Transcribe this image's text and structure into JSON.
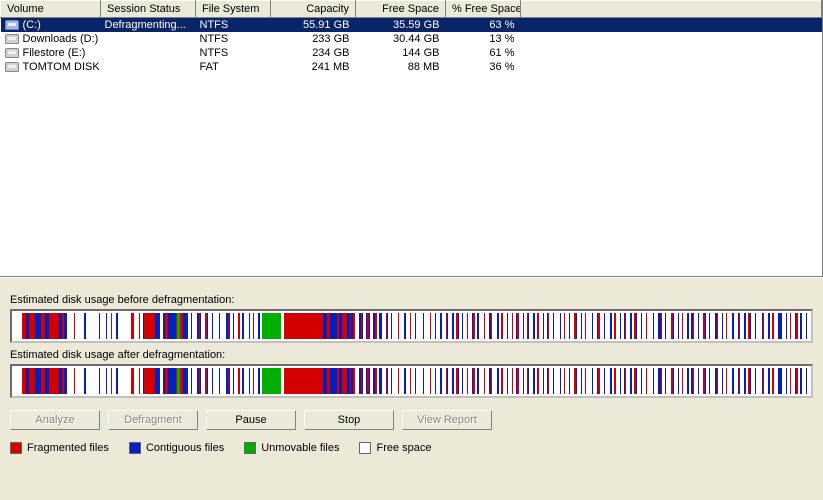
{
  "columns": {
    "volume": "Volume",
    "session_status": "Session Status",
    "file_system": "File System",
    "capacity": "Capacity",
    "free_space": "Free Space",
    "pct_free": "% Free Space"
  },
  "col_widths": {
    "volume": 100,
    "session_status": 95,
    "file_system": 75,
    "capacity": 85,
    "free_space": 90,
    "pct_free": 75
  },
  "volumes": [
    {
      "name": "(C:)",
      "status": "Defragmenting...",
      "fs": "NTFS",
      "capacity": "55.91 GB",
      "free": "35.59 GB",
      "pct": "63 %",
      "selected": true
    },
    {
      "name": "Downloads (D:)",
      "status": "",
      "fs": "NTFS",
      "capacity": "233 GB",
      "free": "30.44 GB",
      "pct": "13 %",
      "selected": false
    },
    {
      "name": "Filestore (E:)",
      "status": "",
      "fs": "NTFS",
      "capacity": "234 GB",
      "free": "144 GB",
      "pct": "61 %",
      "selected": false
    },
    {
      "name": "TOMTOM DISK (G:)",
      "status": "",
      "fs": "FAT",
      "capacity": "241 MB",
      "free": "88 MB",
      "pct": "36 %",
      "selected": false
    }
  ],
  "labels": {
    "before": "Estimated disk usage before defragmentation:",
    "after": "Estimated disk usage after defragmentation:"
  },
  "buttons": {
    "analyze": "Analyze",
    "defragment": "Defragment",
    "pause": "Pause",
    "stop": "Stop",
    "view_report": "View Report"
  },
  "button_state": {
    "analyze": "disabled",
    "defragment": "disabled",
    "pause": "enabled",
    "stop": "enabled",
    "view_report": "disabled"
  },
  "legend": {
    "fragmented": "Fragmented files",
    "contiguous": "Contiguous files",
    "unmovable": "Unmovable files",
    "free": "Free space"
  },
  "stripes_before": [
    [
      "w",
      6
    ],
    [
      "r",
      3
    ],
    [
      "b",
      2
    ],
    [
      "r",
      5
    ],
    [
      "b",
      4
    ],
    [
      "r",
      3
    ],
    [
      "b",
      3
    ],
    [
      "r",
      8
    ],
    [
      "b",
      2
    ],
    [
      "r",
      2
    ],
    [
      "b",
      2
    ],
    [
      "w",
      5
    ],
    [
      "r",
      1
    ],
    [
      "w",
      7
    ],
    [
      "b",
      1
    ],
    [
      "w",
      10
    ],
    [
      "b",
      1
    ],
    [
      "w",
      4
    ],
    [
      "b",
      1
    ],
    [
      "w",
      3
    ],
    [
      "r",
      1
    ],
    [
      "w",
      3
    ],
    [
      "b",
      1
    ],
    [
      "w",
      10
    ],
    [
      "r",
      2
    ],
    [
      "w",
      4
    ],
    [
      "r",
      1
    ],
    [
      "w",
      2
    ],
    [
      "b",
      1
    ],
    [
      "r",
      8
    ],
    [
      "b",
      4
    ],
    [
      "w",
      2
    ],
    [
      "b",
      2
    ],
    [
      "r",
      2
    ],
    [
      "b",
      6
    ],
    [
      "r",
      1
    ],
    [
      "g",
      2
    ],
    [
      "r",
      2
    ],
    [
      "b",
      4
    ],
    [
      "w",
      2
    ],
    [
      "b",
      1
    ],
    [
      "w",
      4
    ],
    [
      "b",
      1
    ],
    [
      "r",
      1
    ],
    [
      "b",
      1
    ],
    [
      "w",
      3
    ],
    [
      "r",
      1
    ],
    [
      "b",
      1
    ],
    [
      "w",
      3
    ],
    [
      "b",
      1
    ],
    [
      "w",
      4
    ],
    [
      "b",
      1
    ],
    [
      "w",
      5
    ],
    [
      "b",
      1
    ],
    [
      "r",
      1
    ],
    [
      "b",
      1
    ],
    [
      "w",
      2
    ],
    [
      "b",
      1
    ],
    [
      "w",
      3
    ],
    [
      "r",
      1
    ],
    [
      "w",
      2
    ],
    [
      "b",
      1
    ],
    [
      "w",
      4
    ],
    [
      "b",
      1
    ],
    [
      "w",
      2
    ],
    [
      "r",
      1
    ],
    [
      "w",
      3
    ],
    [
      "b",
      1
    ],
    [
      "w",
      2
    ],
    [
      "g",
      14
    ],
    [
      "w",
      2
    ],
    [
      "r",
      30
    ],
    [
      "b",
      3
    ],
    [
      "r",
      2
    ],
    [
      "b",
      5
    ],
    [
      "r",
      2
    ],
    [
      "b",
      2
    ],
    [
      "r",
      4
    ],
    [
      "b",
      2
    ],
    [
      "r",
      1
    ],
    [
      "b",
      1
    ],
    [
      "r",
      2
    ],
    [
      "w",
      3
    ],
    [
      "b",
      1
    ],
    [
      "r",
      1
    ],
    [
      "b",
      1
    ],
    [
      "w",
      2
    ],
    [
      "b",
      1
    ],
    [
      "r",
      1
    ],
    [
      "b",
      1
    ],
    [
      "w",
      2
    ],
    [
      "b",
      2
    ],
    [
      "r",
      1
    ],
    [
      "w",
      2
    ],
    [
      "b",
      2
    ],
    [
      "w",
      3
    ],
    [
      "r",
      1
    ],
    [
      "b",
      1
    ],
    [
      "w",
      2
    ],
    [
      "b",
      1
    ],
    [
      "w",
      4
    ],
    [
      "r",
      1
    ],
    [
      "w",
      4
    ],
    [
      "b",
      1
    ],
    [
      "w",
      3
    ],
    [
      "r",
      1
    ],
    [
      "w",
      3
    ],
    [
      "b",
      1
    ],
    [
      "w",
      5
    ],
    [
      "b",
      1
    ],
    [
      "w",
      4
    ],
    [
      "r",
      1
    ],
    [
      "w",
      3
    ],
    [
      "b",
      1
    ],
    [
      "w",
      3
    ],
    [
      "b",
      1
    ],
    [
      "w",
      3
    ],
    [
      "r",
      1
    ],
    [
      "b",
      1
    ],
    [
      "w",
      3
    ],
    [
      "b",
      1
    ],
    [
      "w",
      2
    ],
    [
      "r",
      1
    ],
    [
      "b",
      1
    ],
    [
      "w",
      2
    ],
    [
      "b",
      1
    ],
    [
      "w",
      3
    ],
    [
      "r",
      1
    ],
    [
      "w",
      3
    ],
    [
      "b",
      1
    ],
    [
      "r",
      1
    ],
    [
      "w",
      2
    ],
    [
      "b",
      1
    ],
    [
      "w",
      4
    ],
    [
      "r",
      1
    ],
    [
      "w",
      3
    ],
    [
      "b",
      1
    ],
    [
      "r",
      1
    ],
    [
      "w",
      4
    ],
    [
      "b",
      1
    ],
    [
      "w",
      2
    ],
    [
      "r",
      1
    ],
    [
      "w",
      3
    ],
    [
      "b",
      1
    ],
    [
      "w",
      3
    ],
    [
      "r",
      1
    ],
    [
      "w",
      2
    ],
    [
      "b",
      1
    ],
    [
      "r",
      1
    ],
    [
      "w",
      3
    ],
    [
      "b",
      1
    ],
    [
      "w",
      2
    ],
    [
      "r",
      1
    ],
    [
      "b",
      1
    ],
    [
      "w",
      3
    ],
    [
      "b",
      1
    ],
    [
      "w",
      2
    ],
    [
      "r",
      1
    ],
    [
      "w",
      3
    ],
    [
      "b",
      1
    ],
    [
      "w",
      2
    ],
    [
      "b",
      1
    ],
    [
      "r",
      1
    ],
    [
      "w",
      3
    ],
    [
      "b",
      1
    ],
    [
      "w",
      4
    ],
    [
      "b",
      1
    ],
    [
      "w",
      2
    ],
    [
      "r",
      1
    ],
    [
      "w",
      3
    ],
    [
      "b",
      1
    ],
    [
      "w",
      3
    ],
    [
      "r",
      1
    ],
    [
      "b",
      1
    ],
    [
      "w",
      3
    ],
    [
      "b",
      1
    ],
    [
      "w",
      2
    ],
    [
      "r",
      1
    ],
    [
      "w",
      4
    ],
    [
      "b",
      1
    ],
    [
      "w",
      3
    ],
    [
      "b",
      1
    ],
    [
      "r",
      1
    ],
    [
      "w",
      3
    ],
    [
      "b",
      1
    ],
    [
      "w",
      4
    ],
    [
      "b",
      1
    ],
    [
      "w",
      2
    ],
    [
      "r",
      1
    ],
    [
      "w",
      3
    ],
    [
      "b",
      1
    ],
    [
      "w",
      2
    ],
    [
      "b",
      1
    ],
    [
      "r",
      1
    ],
    [
      "w",
      3
    ],
    [
      "b",
      1
    ],
    [
      "w",
      2
    ],
    [
      "r",
      1
    ],
    [
      "b",
      1
    ],
    [
      "w",
      3
    ],
    [
      "b",
      1
    ],
    [
      "w",
      3
    ],
    [
      "r",
      1
    ],
    [
      "w",
      4
    ],
    [
      "b",
      1
    ],
    [
      "w",
      3
    ],
    [
      "b",
      2
    ],
    [
      "r",
      1
    ],
    [
      "w",
      2
    ],
    [
      "b",
      1
    ],
    [
      "w",
      4
    ],
    [
      "r",
      1
    ],
    [
      "b",
      1
    ],
    [
      "w",
      3
    ],
    [
      "b",
      1
    ],
    [
      "w",
      2
    ],
    [
      "r",
      1
    ],
    [
      "w",
      3
    ],
    [
      "b",
      1
    ],
    [
      "w",
      2
    ],
    [
      "b",
      1
    ],
    [
      "r",
      1
    ],
    [
      "w",
      3
    ],
    [
      "b",
      1
    ],
    [
      "w",
      3
    ],
    [
      "r",
      1
    ],
    [
      "b",
      1
    ],
    [
      "w",
      2
    ],
    [
      "b",
      1
    ],
    [
      "w",
      4
    ],
    [
      "b",
      1
    ],
    [
      "r",
      1
    ],
    [
      "w",
      3
    ],
    [
      "b",
      1
    ],
    [
      "w",
      2
    ],
    [
      "r",
      1
    ],
    [
      "w",
      4
    ],
    [
      "b",
      1
    ],
    [
      "w",
      3
    ],
    [
      "b",
      1
    ],
    [
      "r",
      1
    ],
    [
      "w",
      3
    ],
    [
      "b",
      1
    ],
    [
      "w",
      2
    ],
    [
      "r",
      1
    ],
    [
      "b",
      1
    ],
    [
      "w",
      3
    ],
    [
      "b",
      1
    ],
    [
      "w",
      4
    ],
    [
      "b",
      1
    ],
    [
      "r",
      1
    ],
    [
      "w",
      3
    ],
    [
      "b",
      1
    ],
    [
      "w",
      2
    ],
    [
      "r",
      1
    ],
    [
      "w",
      3
    ],
    [
      "b",
      3
    ],
    [
      "w",
      3
    ],
    [
      "b",
      1
    ],
    [
      "w",
      2
    ],
    [
      "r",
      1
    ],
    [
      "w",
      3
    ],
    [
      "b",
      1
    ],
    [
      "r",
      1
    ],
    [
      "w",
      2
    ],
    [
      "b",
      1
    ],
    [
      "w",
      3
    ],
    [
      "b",
      1
    ],
    [
      "w",
      5
    ]
  ],
  "stripes_after": [
    [
      "w",
      6
    ],
    [
      "r",
      3
    ],
    [
      "b",
      2
    ],
    [
      "r",
      5
    ],
    [
      "b",
      4
    ],
    [
      "r",
      3
    ],
    [
      "b",
      3
    ],
    [
      "r",
      8
    ],
    [
      "b",
      2
    ],
    [
      "r",
      2
    ],
    [
      "b",
      2
    ],
    [
      "w",
      5
    ],
    [
      "r",
      1
    ],
    [
      "w",
      7
    ],
    [
      "b",
      1
    ],
    [
      "w",
      10
    ],
    [
      "b",
      1
    ],
    [
      "w",
      4
    ],
    [
      "b",
      1
    ],
    [
      "w",
      3
    ],
    [
      "r",
      1
    ],
    [
      "w",
      3
    ],
    [
      "b",
      1
    ],
    [
      "w",
      10
    ],
    [
      "r",
      2
    ],
    [
      "w",
      4
    ],
    [
      "r",
      1
    ],
    [
      "w",
      2
    ],
    [
      "b",
      1
    ],
    [
      "r",
      8
    ],
    [
      "b",
      4
    ],
    [
      "w",
      2
    ],
    [
      "b",
      2
    ],
    [
      "r",
      2
    ],
    [
      "b",
      6
    ],
    [
      "r",
      1
    ],
    [
      "g",
      2
    ],
    [
      "r",
      2
    ],
    [
      "b",
      4
    ],
    [
      "w",
      2
    ],
    [
      "b",
      1
    ],
    [
      "w",
      4
    ],
    [
      "b",
      1
    ],
    [
      "r",
      1
    ],
    [
      "b",
      1
    ],
    [
      "w",
      3
    ],
    [
      "r",
      1
    ],
    [
      "b",
      1
    ],
    [
      "w",
      3
    ],
    [
      "b",
      1
    ],
    [
      "w",
      4
    ],
    [
      "b",
      1
    ],
    [
      "w",
      5
    ],
    [
      "b",
      1
    ],
    [
      "r",
      1
    ],
    [
      "b",
      1
    ],
    [
      "w",
      2
    ],
    [
      "b",
      1
    ],
    [
      "w",
      3
    ],
    [
      "r",
      1
    ],
    [
      "w",
      2
    ],
    [
      "b",
      1
    ],
    [
      "w",
      4
    ],
    [
      "b",
      1
    ],
    [
      "w",
      2
    ],
    [
      "r",
      1
    ],
    [
      "w",
      3
    ],
    [
      "b",
      1
    ],
    [
      "w",
      2
    ],
    [
      "g",
      14
    ],
    [
      "w",
      2
    ],
    [
      "r",
      30
    ],
    [
      "b",
      3
    ],
    [
      "r",
      2
    ],
    [
      "b",
      5
    ],
    [
      "r",
      2
    ],
    [
      "b",
      2
    ],
    [
      "r",
      4
    ],
    [
      "b",
      2
    ],
    [
      "r",
      1
    ],
    [
      "b",
      1
    ],
    [
      "r",
      2
    ],
    [
      "w",
      3
    ],
    [
      "b",
      1
    ],
    [
      "r",
      1
    ],
    [
      "b",
      1
    ],
    [
      "w",
      2
    ],
    [
      "b",
      1
    ],
    [
      "r",
      1
    ],
    [
      "b",
      1
    ],
    [
      "w",
      2
    ],
    [
      "b",
      2
    ],
    [
      "r",
      1
    ],
    [
      "w",
      2
    ],
    [
      "b",
      2
    ],
    [
      "w",
      3
    ],
    [
      "r",
      1
    ],
    [
      "b",
      1
    ],
    [
      "w",
      2
    ],
    [
      "b",
      1
    ],
    [
      "w",
      4
    ],
    [
      "r",
      1
    ],
    [
      "w",
      4
    ],
    [
      "b",
      1
    ],
    [
      "w",
      3
    ],
    [
      "r",
      1
    ],
    [
      "w",
      3
    ],
    [
      "b",
      1
    ],
    [
      "w",
      5
    ],
    [
      "b",
      1
    ],
    [
      "w",
      4
    ],
    [
      "r",
      1
    ],
    [
      "w",
      3
    ],
    [
      "b",
      1
    ],
    [
      "w",
      3
    ],
    [
      "b",
      1
    ],
    [
      "w",
      3
    ],
    [
      "r",
      1
    ],
    [
      "b",
      1
    ],
    [
      "w",
      3
    ],
    [
      "b",
      1
    ],
    [
      "w",
      2
    ],
    [
      "r",
      1
    ],
    [
      "b",
      1
    ],
    [
      "w",
      2
    ],
    [
      "b",
      1
    ],
    [
      "w",
      3
    ],
    [
      "r",
      1
    ],
    [
      "w",
      3
    ],
    [
      "b",
      1
    ],
    [
      "r",
      1
    ],
    [
      "w",
      2
    ],
    [
      "b",
      1
    ],
    [
      "w",
      4
    ],
    [
      "r",
      1
    ],
    [
      "w",
      3
    ],
    [
      "b",
      1
    ],
    [
      "r",
      1
    ],
    [
      "w",
      4
    ],
    [
      "b",
      1
    ],
    [
      "w",
      2
    ],
    [
      "r",
      1
    ],
    [
      "w",
      3
    ],
    [
      "b",
      1
    ],
    [
      "w",
      3
    ],
    [
      "r",
      1
    ],
    [
      "w",
      2
    ],
    [
      "b",
      1
    ],
    [
      "r",
      1
    ],
    [
      "w",
      3
    ],
    [
      "b",
      1
    ],
    [
      "w",
      2
    ],
    [
      "r",
      1
    ],
    [
      "b",
      1
    ],
    [
      "w",
      3
    ],
    [
      "b",
      1
    ],
    [
      "w",
      2
    ],
    [
      "r",
      1
    ],
    [
      "w",
      3
    ],
    [
      "b",
      1
    ],
    [
      "w",
      2
    ],
    [
      "b",
      1
    ],
    [
      "r",
      1
    ],
    [
      "w",
      3
    ],
    [
      "b",
      1
    ],
    [
      "w",
      4
    ],
    [
      "b",
      1
    ],
    [
      "w",
      2
    ],
    [
      "r",
      1
    ],
    [
      "w",
      3
    ],
    [
      "b",
      1
    ],
    [
      "w",
      3
    ],
    [
      "r",
      1
    ],
    [
      "b",
      1
    ],
    [
      "w",
      3
    ],
    [
      "b",
      1
    ],
    [
      "w",
      2
    ],
    [
      "r",
      1
    ],
    [
      "w",
      4
    ],
    [
      "b",
      1
    ],
    [
      "w",
      3
    ],
    [
      "b",
      1
    ],
    [
      "r",
      1
    ],
    [
      "w",
      3
    ],
    [
      "b",
      1
    ],
    [
      "w",
      4
    ],
    [
      "b",
      1
    ],
    [
      "w",
      2
    ],
    [
      "r",
      1
    ],
    [
      "w",
      3
    ],
    [
      "b",
      1
    ],
    [
      "w",
      2
    ],
    [
      "b",
      1
    ],
    [
      "r",
      1
    ],
    [
      "w",
      3
    ],
    [
      "b",
      1
    ],
    [
      "w",
      2
    ],
    [
      "r",
      1
    ],
    [
      "b",
      1
    ],
    [
      "w",
      3
    ],
    [
      "b",
      1
    ],
    [
      "w",
      3
    ],
    [
      "r",
      1
    ],
    [
      "w",
      4
    ],
    [
      "b",
      1
    ],
    [
      "w",
      3
    ],
    [
      "b",
      2
    ],
    [
      "r",
      1
    ],
    [
      "w",
      2
    ],
    [
      "b",
      1
    ],
    [
      "w",
      4
    ],
    [
      "r",
      1
    ],
    [
      "b",
      1
    ],
    [
      "w",
      3
    ],
    [
      "b",
      1
    ],
    [
      "w",
      2
    ],
    [
      "r",
      1
    ],
    [
      "w",
      3
    ],
    [
      "b",
      1
    ],
    [
      "w",
      2
    ],
    [
      "b",
      1
    ],
    [
      "r",
      1
    ],
    [
      "w",
      3
    ],
    [
      "b",
      1
    ],
    [
      "w",
      3
    ],
    [
      "r",
      1
    ],
    [
      "b",
      1
    ],
    [
      "w",
      2
    ],
    [
      "b",
      1
    ],
    [
      "w",
      4
    ],
    [
      "b",
      1
    ],
    [
      "r",
      1
    ],
    [
      "w",
      3
    ],
    [
      "b",
      1
    ],
    [
      "w",
      2
    ],
    [
      "r",
      1
    ],
    [
      "w",
      4
    ],
    [
      "b",
      1
    ],
    [
      "w",
      3
    ],
    [
      "b",
      1
    ],
    [
      "r",
      1
    ],
    [
      "w",
      3
    ],
    [
      "b",
      1
    ],
    [
      "w",
      2
    ],
    [
      "r",
      1
    ],
    [
      "b",
      1
    ],
    [
      "w",
      3
    ],
    [
      "b",
      1
    ],
    [
      "w",
      4
    ],
    [
      "b",
      1
    ],
    [
      "r",
      1
    ],
    [
      "w",
      3
    ],
    [
      "b",
      1
    ],
    [
      "w",
      2
    ],
    [
      "r",
      1
    ],
    [
      "w",
      3
    ],
    [
      "b",
      3
    ],
    [
      "w",
      3
    ],
    [
      "b",
      1
    ],
    [
      "w",
      2
    ],
    [
      "r",
      1
    ],
    [
      "w",
      3
    ],
    [
      "b",
      1
    ],
    [
      "r",
      1
    ],
    [
      "w",
      2
    ],
    [
      "b",
      1
    ],
    [
      "w",
      3
    ],
    [
      "b",
      1
    ],
    [
      "w",
      5
    ]
  ]
}
